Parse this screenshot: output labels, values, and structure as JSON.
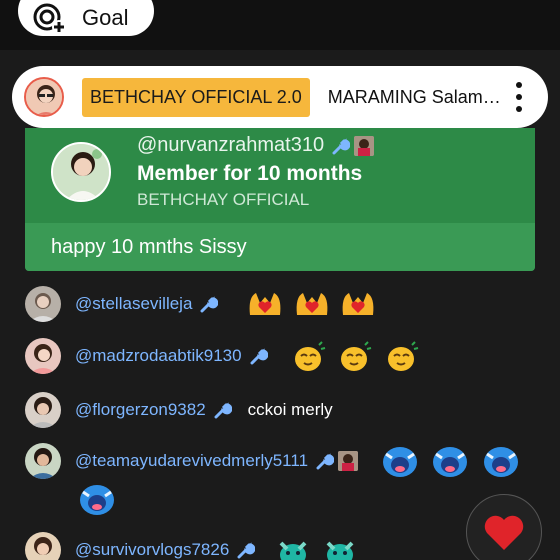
{
  "goal": {
    "label": "Goal",
    "icon": "goal-target-add-icon"
  },
  "pinned": {
    "badge": "BETHCHAY OFFICIAL 2.0",
    "message": "MARAMING Salam…",
    "badge_color": "#f6b73c",
    "menu_icon": "more-vert-icon"
  },
  "membership": {
    "username": "@nurvanzrahmat310",
    "title": "Member for 10 months",
    "channel": "BETHCHAY OFFICIAL",
    "message": "happy 10 mnths Sissy",
    "card_color": "#2d8a47"
  },
  "chat": [
    {
      "username": "@stellasevilleja",
      "badges": [
        "wrench-icon"
      ],
      "emojis": [
        "hand-heart-emoji",
        "hand-heart-emoji",
        "hand-heart-emoji"
      ],
      "text": ""
    },
    {
      "username": "@madzrodaabtik9130",
      "badges": [
        "wrench-icon"
      ],
      "emojis": [
        "yellow-blob-emoji",
        "yellow-blob-emoji",
        "yellow-blob-emoji"
      ],
      "text": ""
    },
    {
      "username": "@florgerzon9382",
      "badges": [
        "wrench-icon"
      ],
      "emojis": [],
      "text": "cckoi merly"
    },
    {
      "username": "@teamayudarevivedmerly5111",
      "badges": [
        "wrench-icon",
        "member-badge-icon"
      ],
      "emojis": [
        "blue-blob-emoji",
        "blue-blob-emoji",
        "blue-blob-emoji",
        "blue-blob-emoji"
      ],
      "text": ""
    },
    {
      "username": "@survivorvlogs7826",
      "badges": [
        "wrench-icon"
      ],
      "emojis": [
        "teal-blob-emoji",
        "teal-blob-emoji"
      ],
      "text": ""
    }
  ],
  "reaction_button": {
    "icon": "heart-icon",
    "color": "#e0242a"
  },
  "colors": {
    "username": "#7eb6ff",
    "background": "#1b1b1b"
  }
}
